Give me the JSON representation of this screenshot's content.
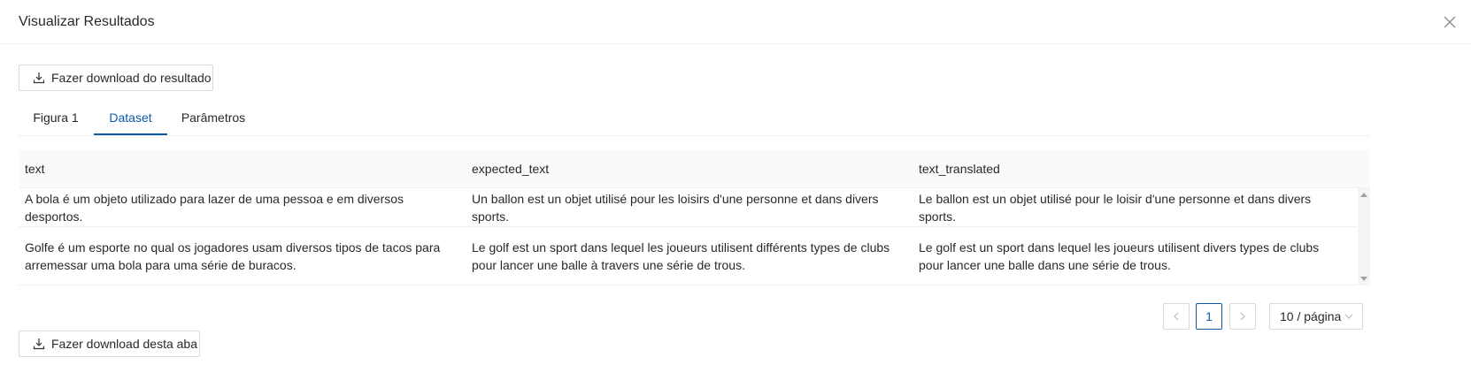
{
  "modal": {
    "title": "Visualizar Resultados"
  },
  "buttons": {
    "download_result": "Fazer download do resultado",
    "download_tab": "Fazer download desta aba"
  },
  "tabs": [
    {
      "label": "Figura 1",
      "active": false
    },
    {
      "label": "Dataset",
      "active": true
    },
    {
      "label": "Parâmetros",
      "active": false
    }
  ],
  "table": {
    "columns": [
      "text",
      "expected_text",
      "text_translated"
    ],
    "rows": [
      [
        "A bola é um objeto utilizado para lazer de uma pessoa e em diversos desportos.",
        "Un ballon est un objet utilisé pour les loisirs d'une personne et dans divers sports.",
        "Le ballon est un objet utilisé pour le loisir d'une personne et dans divers sports."
      ],
      [
        "Golfe é um esporte no qual os jogadores usam diversos tipos de tacos para arremessar uma bola para uma série de buracos.",
        "Le golf est un sport dans lequel les joueurs utilisent différents types de clubs pour lancer une balle à travers une série de trous.",
        "Le golf est un sport dans lequel les joueurs utilisent divers types de clubs pour lancer une balle dans une série de trous."
      ]
    ]
  },
  "pagination": {
    "current_page": "1",
    "page_size": "10 / página"
  },
  "icons": {
    "close": "close-icon",
    "download": "download-icon",
    "prev": "chevron-left-icon",
    "next": "chevron-right-icon",
    "select": "chevron-down-icon"
  },
  "colors": {
    "accent": "#0a58a8",
    "border": "#d9d9d9",
    "header_bg": "#fafafa"
  }
}
